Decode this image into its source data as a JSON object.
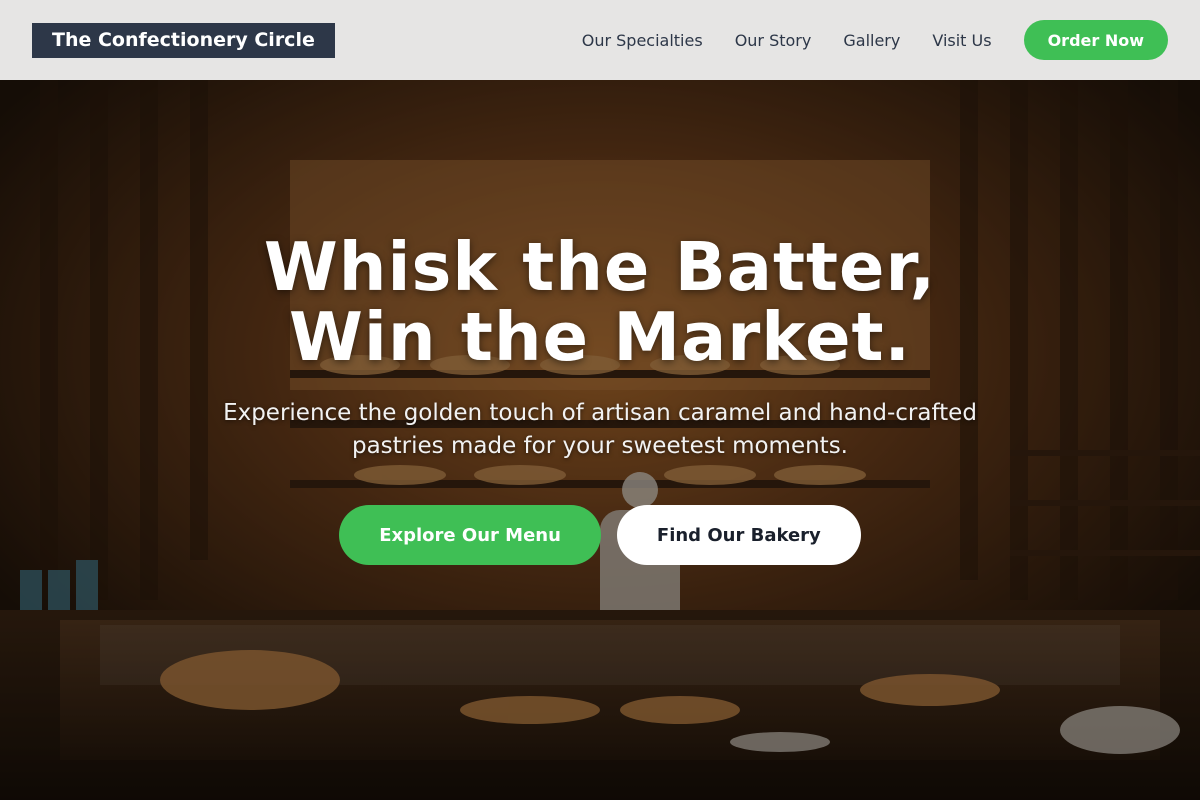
{
  "header": {
    "logo": "The Confectionery Circle",
    "nav": {
      "specialties": "Our Specialties",
      "story": "Our Story",
      "gallery": "Gallery",
      "visit": "Visit Us"
    },
    "order_label": "Order Now"
  },
  "hero": {
    "headline_line1": "Whisk the Batter,",
    "headline_line2": "Win the Market.",
    "subtitle": "Experience the golden touch of artisan caramel and hand-crafted pastries made for your sweetest moments.",
    "primary_cta": "Explore Our Menu",
    "secondary_cta": "Find Our Bakery"
  },
  "colors": {
    "accent": "#3fbf55",
    "logo_bg": "#2d3748",
    "header_bg": "#f0f0f0",
    "nav_text": "#2d3748"
  }
}
